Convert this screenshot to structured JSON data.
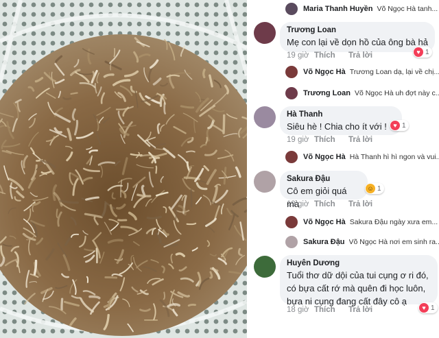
{
  "comments": [
    {
      "type": "reply",
      "name": "Maria Thanh Huyền",
      "text": "Võ Ngọc Hà  tanh..."
    },
    {
      "type": "main",
      "name": "Trương Loan",
      "text": "Mẹ con lại về dọn hồ của ông bà hả",
      "time": "19 giờ",
      "like": "Thích",
      "reply": "Trả lời",
      "reaction": "1",
      "reaction_icon": "heart-icon",
      "reaction_color": "#f33e58"
    },
    {
      "type": "reply",
      "name": "Võ Ngọc Hà",
      "text": "Trương Loan dạ, lại về chị..."
    },
    {
      "type": "reply",
      "name": "Trương Loan",
      "text": "Võ Ngọc Hà uh đợt này c..."
    },
    {
      "type": "main",
      "name": "Hà Thanh",
      "text": "Siêu hè  ! Chia cho ít với  !",
      "time": "19 giờ",
      "like": "Thích",
      "reply": "Trả lời",
      "reaction": "1",
      "reaction_icon": "heart-icon",
      "reaction_color": "#f33e58"
    },
    {
      "type": "reply",
      "name": "Võ Ngọc Hà",
      "text": "Hà Thanh hì hì ngon và vui..."
    },
    {
      "type": "main",
      "name": "Sakura Đậu",
      "text": "Cô em giỏi quá mà",
      "time": "19 giờ",
      "like": "Thích",
      "reply": "Trả lời",
      "reaction": "1",
      "reaction_icon": "haha-icon",
      "reaction_color": "#f7b125"
    },
    {
      "type": "reply",
      "name": "Võ Ngọc Hà",
      "text": "Sakura Đậu  ngày xưa em..."
    },
    {
      "type": "reply",
      "name": "Sakura Đậu",
      "text": "Võ Ngọc Hà nơi em sinh ra..."
    },
    {
      "type": "main",
      "name": "Huyên Dương",
      "text_lines": [
        "Tuổi thơ dữ dội của tui cụng ơ ri đó,",
        "có bựa cất rớ mà quên đi học luôn,",
        "bựa ni cụng đang cất đây cô ạ"
      ],
      "time": "18 giờ",
      "like": "Thích",
      "reply": "Trả lời",
      "reaction": "1",
      "reaction_icon": "heart-icon",
      "reaction_color": "#f33e58"
    }
  ],
  "colors": {
    "bubble": "#f0f2f5",
    "meta": "#8a8d91",
    "name": "#1c1e21"
  }
}
